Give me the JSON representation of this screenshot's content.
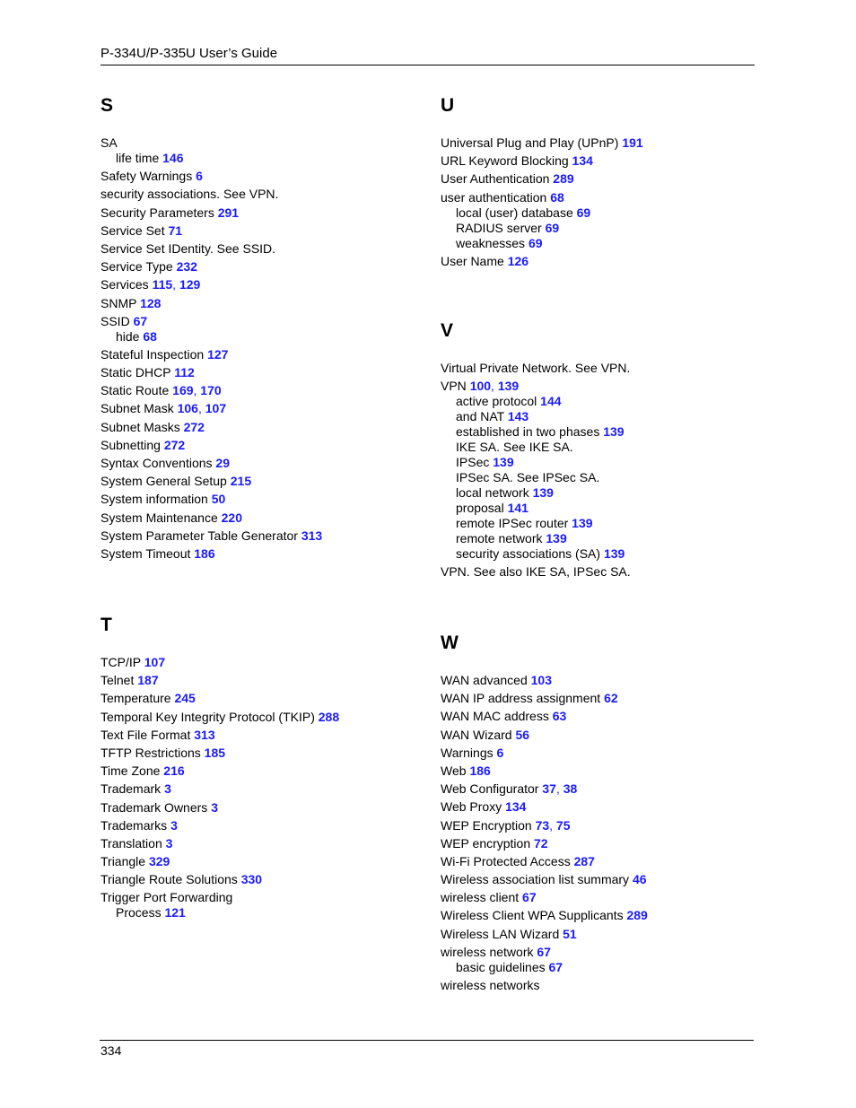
{
  "header": {
    "title": "P-334U/P-335U User’s Guide"
  },
  "footer": {
    "page_number": "334"
  },
  "colors": {
    "link": "#1a1aff",
    "text": "#000000"
  },
  "sections": [
    {
      "letter": "S",
      "entries": [
        {
          "text": "SA",
          "pages": [],
          "level": 0
        },
        {
          "text": "life time",
          "pages": [
            "146"
          ],
          "level": 1
        },
        {
          "text": "Safety Warnings",
          "pages": [
            "6"
          ],
          "level": 0
        },
        {
          "text": "security associations. See VPN.",
          "pages": [],
          "level": 0
        },
        {
          "text": "Security Parameters",
          "pages": [
            "291"
          ],
          "level": 0
        },
        {
          "text": "Service Set",
          "pages": [
            "71"
          ],
          "level": 0
        },
        {
          "text": "Service Set IDentity. See SSID.",
          "pages": [],
          "level": 0
        },
        {
          "text": "Service Type",
          "pages": [
            "232"
          ],
          "level": 0
        },
        {
          "text": "Services",
          "pages": [
            "115",
            "129"
          ],
          "level": 0
        },
        {
          "text": "SNMP",
          "pages": [
            "128"
          ],
          "level": 0
        },
        {
          "text": "SSID",
          "pages": [
            "67"
          ],
          "level": 0
        },
        {
          "text": "hide",
          "pages": [
            "68"
          ],
          "level": 1
        },
        {
          "text": "Stateful Inspection",
          "pages": [
            "127"
          ],
          "level": 0
        },
        {
          "text": "Static DHCP",
          "pages": [
            "112"
          ],
          "level": 0
        },
        {
          "text": "Static Route",
          "pages": [
            "169",
            "170"
          ],
          "level": 0
        },
        {
          "text": "Subnet Mask",
          "pages": [
            "106",
            "107"
          ],
          "level": 0
        },
        {
          "text": "Subnet Masks",
          "pages": [
            "272"
          ],
          "level": 0
        },
        {
          "text": "Subnetting",
          "pages": [
            "272"
          ],
          "level": 0
        },
        {
          "text": "Syntax Conventions",
          "pages": [
            "29"
          ],
          "level": 0
        },
        {
          "text": "System General Setup",
          "pages": [
            "215"
          ],
          "level": 0
        },
        {
          "text": "System information",
          "pages": [
            "50"
          ],
          "level": 0
        },
        {
          "text": "System Maintenance",
          "pages": [
            "220"
          ],
          "level": 0
        },
        {
          "text": "System Parameter Table Generator",
          "pages": [
            "313"
          ],
          "level": 0
        },
        {
          "text": "System Timeout",
          "pages": [
            "186"
          ],
          "level": 0
        }
      ]
    },
    {
      "letter": "T",
      "entries": [
        {
          "text": "TCP/IP",
          "pages": [
            "107"
          ],
          "level": 0
        },
        {
          "text": "Telnet",
          "pages": [
            "187"
          ],
          "level": 0
        },
        {
          "text": "Temperature",
          "pages": [
            "245"
          ],
          "level": 0
        },
        {
          "text": "Temporal Key Integrity Protocol (TKIP)",
          "pages": [
            "288"
          ],
          "level": 0
        },
        {
          "text": "Text File Format",
          "pages": [
            "313"
          ],
          "level": 0
        },
        {
          "text": "TFTP Restrictions",
          "pages": [
            "185"
          ],
          "level": 0
        },
        {
          "text": "Time Zone",
          "pages": [
            "216"
          ],
          "level": 0
        },
        {
          "text": "Trademark",
          "pages": [
            "3"
          ],
          "level": 0
        },
        {
          "text": "Trademark Owners",
          "pages": [
            "3"
          ],
          "level": 0
        },
        {
          "text": "Trademarks",
          "pages": [
            "3"
          ],
          "level": 0
        },
        {
          "text": "Translation",
          "pages": [
            "3"
          ],
          "level": 0
        },
        {
          "text": "Triangle",
          "pages": [
            "329"
          ],
          "level": 0
        },
        {
          "text": "Triangle Route Solutions",
          "pages": [
            "330"
          ],
          "level": 0
        },
        {
          "text": "Trigger Port Forwarding",
          "pages": [],
          "level": 0
        },
        {
          "text": "Process",
          "pages": [
            "121"
          ],
          "level": 1
        }
      ]
    },
    {
      "letter": "U",
      "entries": [
        {
          "text": "Universal Plug and Play (UPnP)",
          "pages": [
            "191"
          ],
          "level": 0
        },
        {
          "text": "URL Keyword Blocking",
          "pages": [
            "134"
          ],
          "level": 0
        },
        {
          "text": "User Authentication",
          "pages": [
            "289"
          ],
          "level": 0
        },
        {
          "text": "user authentication",
          "pages": [
            "68"
          ],
          "level": 0
        },
        {
          "text": "local (user) database",
          "pages": [
            "69"
          ],
          "level": 1
        },
        {
          "text": "RADIUS server",
          "pages": [
            "69"
          ],
          "level": 1
        },
        {
          "text": "weaknesses",
          "pages": [
            "69"
          ],
          "level": 1
        },
        {
          "text": "User Name",
          "pages": [
            "126"
          ],
          "level": 0
        }
      ]
    },
    {
      "letter": "V",
      "entries": [
        {
          "text": "Virtual Private Network. See VPN.",
          "pages": [],
          "level": 0
        },
        {
          "text": "VPN",
          "pages": [
            "100",
            "139"
          ],
          "level": 0
        },
        {
          "text": "active protocol",
          "pages": [
            "144"
          ],
          "level": 1
        },
        {
          "text": "and NAT",
          "pages": [
            "143"
          ],
          "level": 1
        },
        {
          "text": "established in two phases",
          "pages": [
            "139"
          ],
          "level": 1
        },
        {
          "text": "IKE SA. See IKE SA.",
          "pages": [],
          "level": 1
        },
        {
          "text": "IPSec",
          "pages": [
            "139"
          ],
          "level": 1
        },
        {
          "text": "IPSec SA. See IPSec SA.",
          "pages": [],
          "level": 1
        },
        {
          "text": "local network",
          "pages": [
            "139"
          ],
          "level": 1
        },
        {
          "text": "proposal",
          "pages": [
            "141"
          ],
          "level": 1
        },
        {
          "text": "remote IPSec router",
          "pages": [
            "139"
          ],
          "level": 1
        },
        {
          "text": "remote network",
          "pages": [
            "139"
          ],
          "level": 1
        },
        {
          "text": "security associations (SA)",
          "pages": [
            "139"
          ],
          "level": 1
        },
        {
          "text": "VPN. See also IKE SA, IPSec SA.",
          "pages": [],
          "level": 0
        }
      ]
    },
    {
      "letter": "W",
      "entries": [
        {
          "text": "WAN advanced",
          "pages": [
            "103"
          ],
          "level": 0
        },
        {
          "text": "WAN IP address assignment",
          "pages": [
            "62"
          ],
          "level": 0
        },
        {
          "text": "WAN MAC address",
          "pages": [
            "63"
          ],
          "level": 0
        },
        {
          "text": "WAN Wizard",
          "pages": [
            "56"
          ],
          "level": 0
        },
        {
          "text": "Warnings",
          "pages": [
            "6"
          ],
          "level": 0
        },
        {
          "text": "Web",
          "pages": [
            "186"
          ],
          "level": 0
        },
        {
          "text": "Web Configurator",
          "pages": [
            "37",
            "38"
          ],
          "level": 0
        },
        {
          "text": "Web Proxy",
          "pages": [
            "134"
          ],
          "level": 0
        },
        {
          "text": "WEP Encryption",
          "pages": [
            "73",
            "75"
          ],
          "level": 0
        },
        {
          "text": "WEP encryption",
          "pages": [
            "72"
          ],
          "level": 0
        },
        {
          "text": "Wi-Fi Protected Access",
          "pages": [
            "287"
          ],
          "level": 0
        },
        {
          "text": "Wireless association list summary",
          "pages": [
            "46"
          ],
          "level": 0
        },
        {
          "text": "wireless client",
          "pages": [
            "67"
          ],
          "level": 0
        },
        {
          "text": "Wireless Client WPA Supplicants",
          "pages": [
            "289"
          ],
          "level": 0
        },
        {
          "text": "Wireless LAN Wizard",
          "pages": [
            "51"
          ],
          "level": 0
        },
        {
          "text": "wireless network",
          "pages": [
            "67"
          ],
          "level": 0
        },
        {
          "text": "basic guidelines",
          "pages": [
            "67"
          ],
          "level": 1
        },
        {
          "text": "wireless networks",
          "pages": [],
          "level": 0
        }
      ]
    }
  ]
}
